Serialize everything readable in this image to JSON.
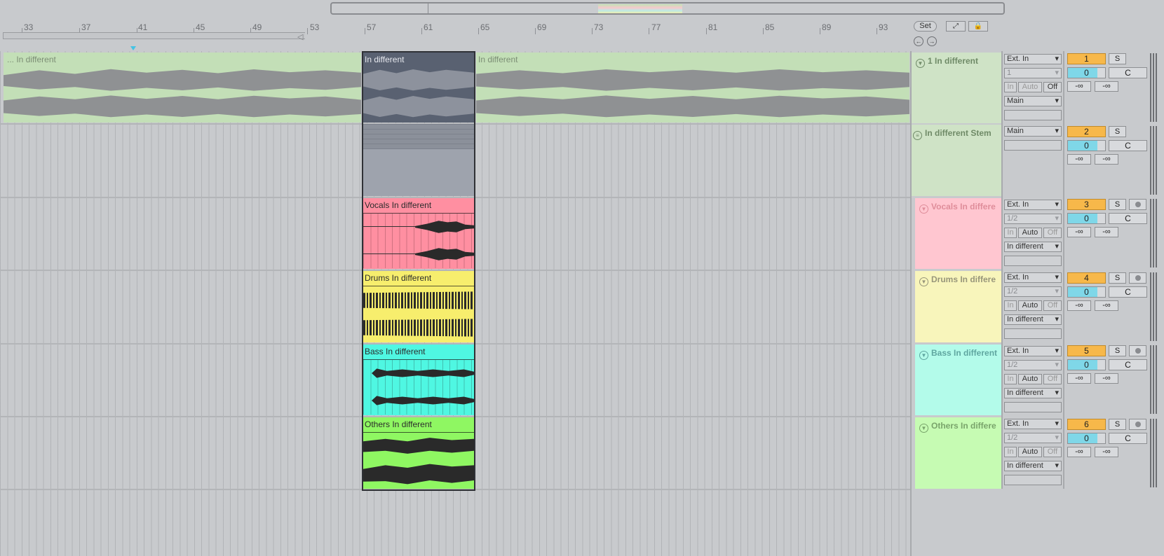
{
  "ruler": {
    "bars": [
      "33",
      "37",
      "41",
      "45",
      "49",
      "53",
      "57",
      "61",
      "65",
      "69",
      "73",
      "77",
      "81",
      "85",
      "89",
      "93"
    ]
  },
  "controls": {
    "set_label": "Set",
    "expand_icon": "expand-arrows-icon",
    "lock_icon": "lock-icon",
    "prev_icon": "arrow-left-icon",
    "next_icon": "arrow-right-icon"
  },
  "clips": {
    "main_left": "... In different",
    "main_selected": "In different",
    "main_right": "In different",
    "vocals": "Vocals In different",
    "drums": "Drums In different",
    "bass": "Bass In different",
    "others": "Others In different"
  },
  "tracks": [
    {
      "name": "1 In different",
      "input": "Ext. In",
      "channel": "1",
      "monitor": [
        "In",
        "Auto",
        "Off"
      ],
      "output": "Main",
      "number": "1",
      "solo": "S",
      "volume": "0",
      "pan": "C",
      "peak_l": "-∞",
      "peak_r": "-∞",
      "color": "#cfe3c6"
    },
    {
      "name": "In different  Stem",
      "input": "Main",
      "number": "2",
      "solo": "S",
      "volume": "0",
      "pan": "C",
      "peak_l": "-∞",
      "peak_r": "-∞",
      "color": "#cfe3c6"
    },
    {
      "name": "Vocals In differe",
      "input": "Ext. In",
      "channel": "1/2",
      "monitor": [
        "In",
        "Auto",
        "Off"
      ],
      "output": "In different",
      "number": "3",
      "solo": "S",
      "volume": "0",
      "pan": "C",
      "peak_l": "-∞",
      "peak_r": "-∞",
      "color": "#ffc6d0"
    },
    {
      "name": "Drums In differe",
      "input": "Ext. In",
      "channel": "1/2",
      "monitor": [
        "In",
        "Auto",
        "Off"
      ],
      "output": "In different",
      "number": "4",
      "solo": "S",
      "volume": "0",
      "pan": "C",
      "peak_l": "-∞",
      "peak_r": "-∞",
      "color": "#f8f5bb"
    },
    {
      "name": "Bass In different",
      "input": "Ext. In",
      "channel": "1/2",
      "monitor": [
        "In",
        "Auto",
        "Off"
      ],
      "output": "In different",
      "number": "5",
      "solo": "S",
      "volume": "0",
      "pan": "C",
      "peak_l": "-∞",
      "peak_r": "-∞",
      "color": "#b3fbea"
    },
    {
      "name": "Others In differe",
      "input": "Ext. In",
      "channel": "1/2",
      "monitor": [
        "In",
        "Auto",
        "Off"
      ],
      "output": "In different",
      "number": "6",
      "solo": "S",
      "volume": "0",
      "pan": "C",
      "peak_l": "-∞",
      "peak_r": "-∞",
      "color": "#c6fbb3"
    }
  ],
  "colors": {
    "main": "#c3dfb7",
    "selected": "#596171",
    "vocals": "#ff8fa1",
    "drums": "#f7ee6d",
    "bass": "#4ff7e2",
    "others": "#8ff762"
  }
}
